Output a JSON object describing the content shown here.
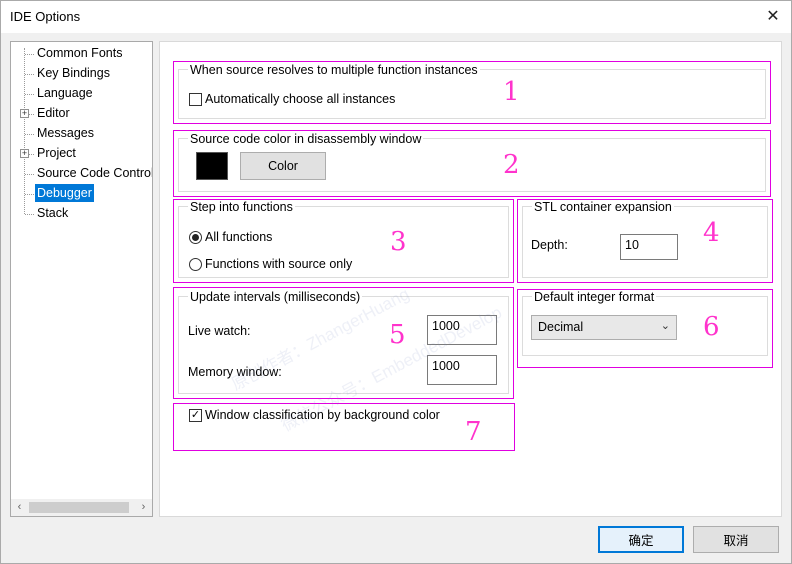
{
  "window": {
    "title": "IDE Options",
    "close_symbol": "✕"
  },
  "tree": {
    "items": [
      {
        "label": "Common Fonts"
      },
      {
        "label": "Key Bindings"
      },
      {
        "label": "Language"
      },
      {
        "label": "Editor",
        "expander": "+"
      },
      {
        "label": "Messages"
      },
      {
        "label": "Project",
        "expander": "+"
      },
      {
        "label": "Source Code Control"
      },
      {
        "label": "Debugger",
        "selected": true
      },
      {
        "label": "Stack"
      }
    ],
    "scroll_left": "‹",
    "scroll_right": "›"
  },
  "groups": {
    "multi_instances": {
      "title": "When source resolves to multiple function instances",
      "checkbox_label": "Automatically choose all instances",
      "checked": false,
      "number": "1"
    },
    "source_color": {
      "title": "Source code color in disassembly window",
      "color_value": "#000000",
      "button_label": "Color",
      "number": "2"
    },
    "step_into": {
      "title": "Step into functions",
      "options": [
        "All functions",
        "Functions with source only"
      ],
      "selected_index": 0,
      "number": "3"
    },
    "stl": {
      "title": "STL container expansion",
      "depth_label": "Depth:",
      "depth_value": "10",
      "number": "4"
    },
    "update_intervals": {
      "title": "Update intervals (milliseconds)",
      "live_watch_label": "Live watch:",
      "live_watch_value": "1000",
      "memory_window_label": "Memory window:",
      "memory_window_value": "1000",
      "number": "5"
    },
    "integer_format": {
      "title": "Default integer format",
      "selected": "Decimal",
      "number": "6"
    },
    "window_class": {
      "checkbox_label": "Window classification by background color",
      "checked": true,
      "number": "7"
    }
  },
  "watermark": {
    "line1": "原创作者：ZhangerHuang",
    "line2": "微信公众号：EmbeddedDevelop"
  },
  "footer": {
    "ok_label": "确定",
    "cancel_label": "取消"
  },
  "colors": {
    "annotation": "#e000e0",
    "number": "#ff33cc",
    "selection": "#0078d7"
  }
}
